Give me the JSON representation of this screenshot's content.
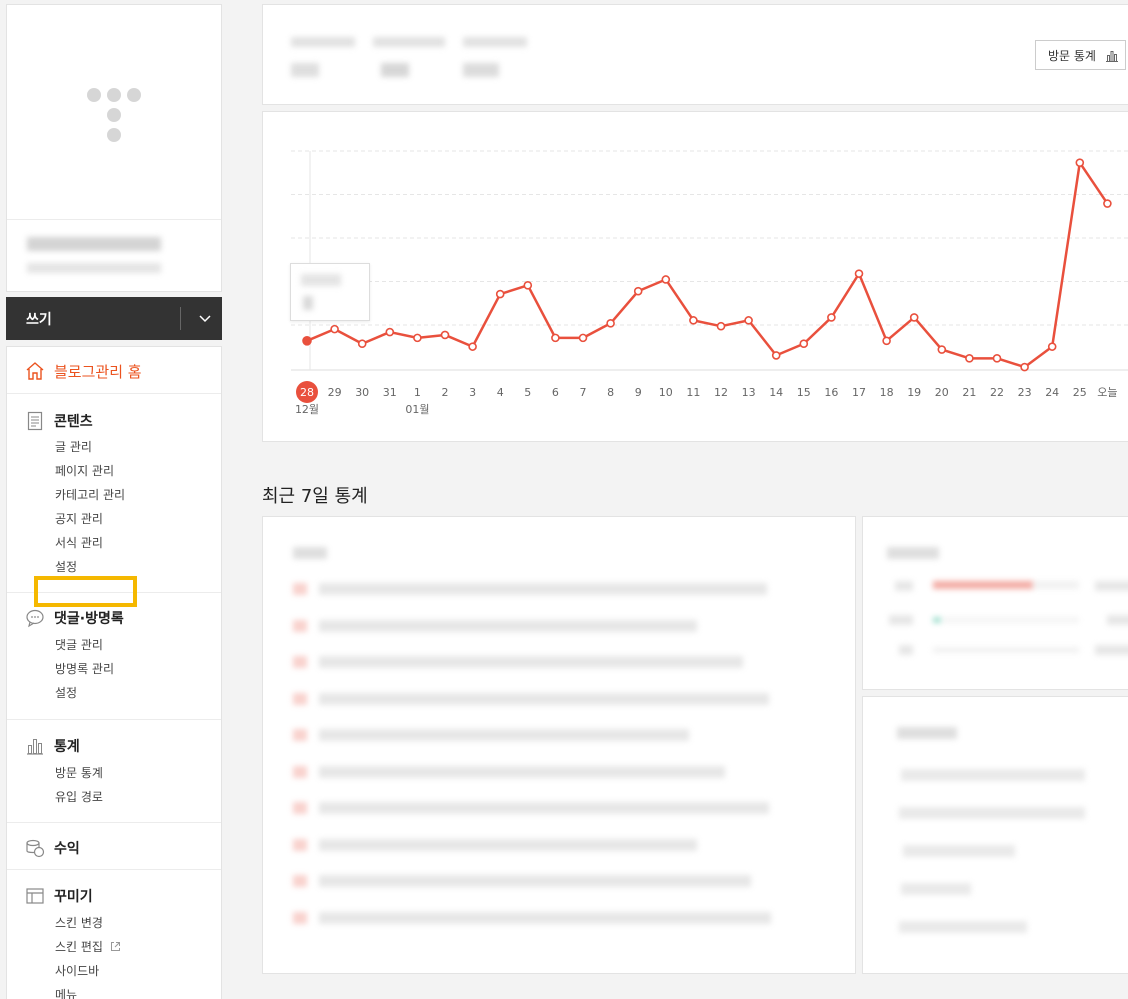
{
  "write": {
    "label": "쓰기"
  },
  "menu": {
    "home": {
      "label": "블로그관리 홈"
    },
    "contents": {
      "title": "콘텐츠",
      "items": [
        "글 관리",
        "페이지 관리",
        "카테고리 관리",
        "공지 관리",
        "서식 관리",
        "설정"
      ]
    },
    "comments": {
      "title": "댓글·방명록",
      "items": [
        "댓글 관리",
        "방명록 관리",
        "설정"
      ]
    },
    "stats": {
      "title": "통계",
      "items": [
        "방문 통계",
        "유입 경로"
      ]
    },
    "revenue": {
      "title": "수익"
    },
    "decorate": {
      "title": "꾸미기",
      "items": [
        "스킨 변경",
        "스킨 편집",
        "사이드바",
        "메뉴"
      ]
    }
  },
  "stats_button": {
    "label": "방문 통계"
  },
  "recent_title": "최근 7일 통계",
  "colors": {
    "accent": "#e9503d",
    "highlight": "#f5b800",
    "write_bg": "#333333"
  },
  "chart_data": {
    "type": "line",
    "x": [
      "28",
      "29",
      "30",
      "31",
      "1",
      "2",
      "3",
      "4",
      "5",
      "6",
      "7",
      "8",
      "9",
      "10",
      "11",
      "12",
      "13",
      "14",
      "15",
      "16",
      "17",
      "18",
      "19",
      "20",
      "21",
      "22",
      "23",
      "24",
      "25",
      "오늘"
    ],
    "month_labels": [
      {
        "at": "28",
        "label": "12월"
      },
      {
        "at": "1",
        "label": "01월"
      }
    ],
    "series": [
      {
        "values": [
          10,
          14,
          9,
          13,
          11,
          12,
          8,
          26,
          29,
          11,
          11,
          16,
          27,
          31,
          17,
          15,
          17,
          5,
          9,
          18,
          33,
          10,
          18,
          7,
          4,
          4,
          1,
          8,
          71,
          57
        ]
      }
    ],
    "ylim": [
      0,
      75
    ],
    "selected": "28",
    "grid": true
  }
}
